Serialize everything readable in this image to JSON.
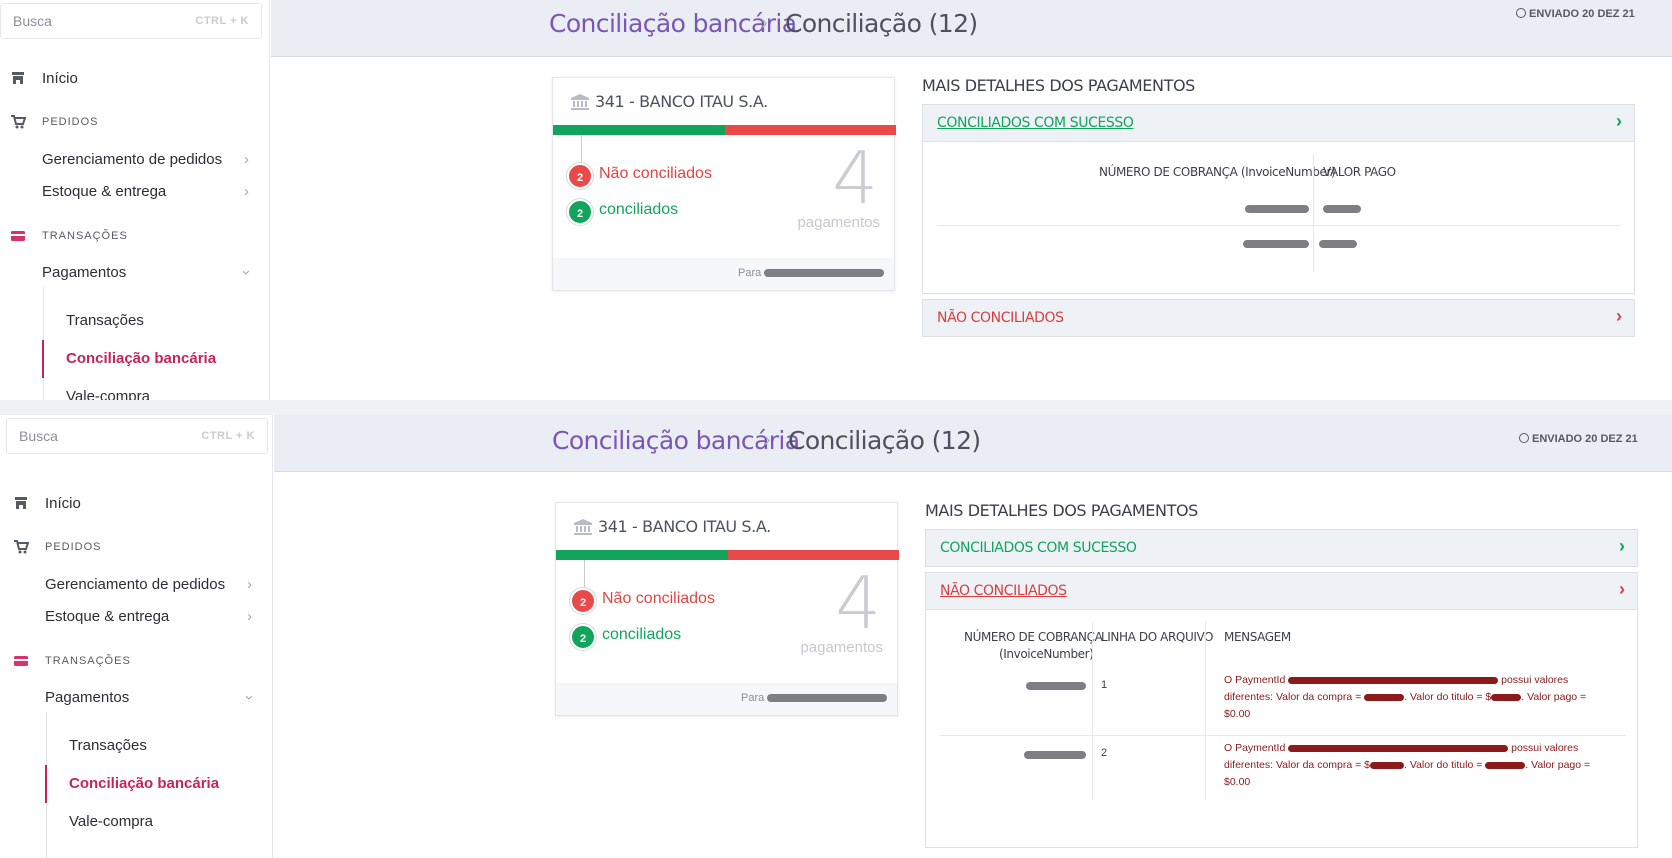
{
  "sidebar": {
    "search_placeholder": "Busca",
    "search_shortcut": "CTRL + K",
    "home": "Início",
    "orders_section": "PEDIDOS",
    "orders_items": [
      "Gerenciamento de pedidos",
      "Estoque & entrega"
    ],
    "transactions_section": "TRANSAÇÕES",
    "payments": "Pagamentos",
    "payments_sub": [
      "Transações",
      "Conciliação bancária",
      "Vale-compra"
    ],
    "icons": {
      "home": "store-icon",
      "orders": "cart-icon",
      "transactions": "credit-card-icon"
    }
  },
  "header": {
    "breadcrumb_parent": "Conciliação bancária",
    "breadcrumb_current": "Conciliação (12)",
    "sent": "ENVIADO 20 DEZ 21"
  },
  "card": {
    "bank": "341 - BANCO ITAU S.A.",
    "not_reconciled_count": "2",
    "not_reconciled_label": "Não conciliados",
    "reconciled_count": "2",
    "reconciled_label": "conciliados",
    "total": "4",
    "total_label": "pagamentos",
    "footer_label": "Para",
    "colors": {
      "green": "#13a45c",
      "red": "#e84a4a"
    }
  },
  "details": {
    "title": "MAIS DETALHES DOS PAGAMENTOS",
    "success_label": "CONCILIADOS COM SUCESSO",
    "failed_label": "NÃO CONCILIADOS",
    "success_table": {
      "headers": [
        "NÚMERO DE COBRANÇA (InvoiceNumber)",
        "VALOR PAGO"
      ]
    },
    "failed_table": {
      "headers": [
        "NÚMERO DE COBRANÇA",
        "(InvoiceNumber)",
        "LINHA DO ARQUIVO",
        "MENSAGEM"
      ],
      "rows": [
        {
          "line": "1",
          "msg_a": "O PaymentId",
          "msg_b": "possui valores diferentes: Valor da compra =",
          "msg_c": "Valor do titulo = $",
          "msg_d": "Valor pago = $0.00"
        },
        {
          "line": "2",
          "msg_a": "O PaymentId",
          "msg_b": "possui valores diferentes: Valor da compra = $",
          "msg_c": "Valor do titulo =",
          "msg_d": ". Valor pago = $0.00"
        }
      ]
    }
  }
}
